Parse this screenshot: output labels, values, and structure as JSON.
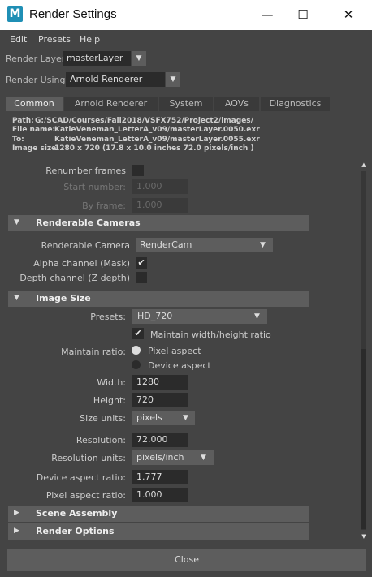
{
  "window": {
    "app_icon_letter": "M",
    "title": "Render Settings",
    "minimize": "—",
    "maximize": "☐",
    "close": "✕"
  },
  "menu": [
    "Edit",
    "Presets",
    "Help"
  ],
  "render_layer": {
    "label": "Render Layer",
    "value": "masterLayer"
  },
  "render_using": {
    "label": "Render Using",
    "value": "Arnold Renderer"
  },
  "tabs": [
    "Common",
    "Arnold Renderer",
    "System",
    "AOVs",
    "Diagnostics"
  ],
  "info": {
    "path_key": "Path:",
    "path": "G:/SCAD/Courses/Fall2018/VSFX752/Project2/images/",
    "file_key": "File name:",
    "file": "KatieVeneman_LetterA_v09/masterLayer.0050.exr",
    "to_key": "To:",
    "to": "KatieVeneman_LetterA_v09/masterLayer.0055.exr",
    "size_key": "Image size:",
    "size": "1280 x 720 (17.8 x 10.0 inches 72.0 pixels/inch )"
  },
  "frame_range": {
    "renumber_label": "Renumber frames",
    "start_label": "Start number:",
    "start_value": "1.000",
    "by_label": "By frame:",
    "by_value": "1.000"
  },
  "renderable_cameras": {
    "title": "Renderable Cameras",
    "camera_label": "Renderable Camera",
    "camera_value": "RenderCam",
    "alpha_label": "Alpha channel (Mask)",
    "alpha_checked": true,
    "depth_label": "Depth channel (Z depth)",
    "depth_checked": false
  },
  "image_size": {
    "title": "Image Size",
    "presets_label": "Presets:",
    "presets_value": "HD_720",
    "maintain_wh_label": "Maintain width/height ratio",
    "maintain_wh_checked": true,
    "maintain_ratio_label": "Maintain ratio:",
    "pixel_aspect_label": "Pixel aspect",
    "device_aspect_label": "Device aspect",
    "selected_ratio": "Pixel aspect",
    "width_label": "Width:",
    "width_value": "1280",
    "height_label": "Height:",
    "height_value": "720",
    "size_units_label": "Size units:",
    "size_units_value": "pixels",
    "resolution_label": "Resolution:",
    "resolution_value": "72.000",
    "resolution_units_label": "Resolution units:",
    "resolution_units_value": "pixels/inch",
    "device_aspect_ratio_label": "Device aspect ratio:",
    "device_aspect_ratio_value": "1.777",
    "pixel_aspect_ratio_label": "Pixel aspect ratio:",
    "pixel_aspect_ratio_value": "1.000"
  },
  "collapsed_sections": [
    "Scene Assembly",
    "Render Options"
  ],
  "close_button": "Close",
  "icons": {
    "expanded": "▼",
    "collapsed": "▶",
    "dropdown": "▼",
    "check": "✔",
    "scroll_up": "▲",
    "scroll_down": "▼"
  },
  "colors": {
    "panel": "#444444",
    "section": "#5d5d5d",
    "field": "#2b2b2b",
    "app_icon": "#1f8fb5"
  }
}
